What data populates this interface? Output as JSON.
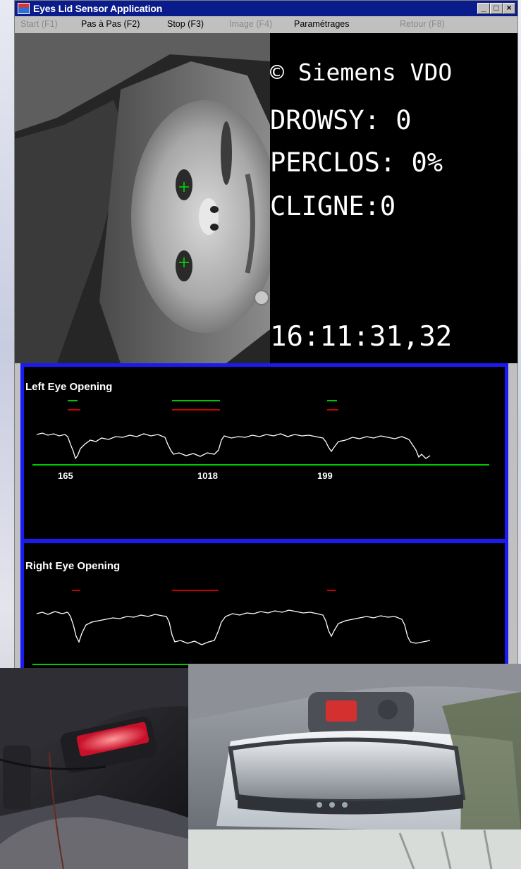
{
  "window": {
    "title": "Eyes Lid Sensor Application",
    "buttons": [
      "_",
      "□",
      "×"
    ]
  },
  "menu": [
    {
      "label": "Start  (F1)",
      "enabled": false
    },
    {
      "label": "Pas à Pas  (F2)",
      "enabled": true
    },
    {
      "label": "Stop  (F3)",
      "enabled": true
    },
    {
      "label": "Image  (F4)",
      "enabled": false
    },
    {
      "label": "Paramétrages",
      "enabled": true
    },
    {
      "label": "Retour  (F8)",
      "enabled": false
    }
  ],
  "info": {
    "copyright": "© Siemens VDO",
    "drowsy": "DROWSY:  0",
    "perclos": "PERCLOS:  0%",
    "cligne": "CLIGNE:0",
    "time": "16:11:31,32"
  },
  "left_eye": {
    "label": "Left Eye Opening",
    "values": [
      "165",
      "1018",
      "199"
    ]
  },
  "right_eye": {
    "label": "Right Eye Opening"
  },
  "colors": {
    "title_bar": "#0a1b8c",
    "panel_border": "#1a1af5",
    "green_marker": "#00c800",
    "red_marker": "#c80000",
    "trace": "#ffffff"
  }
}
